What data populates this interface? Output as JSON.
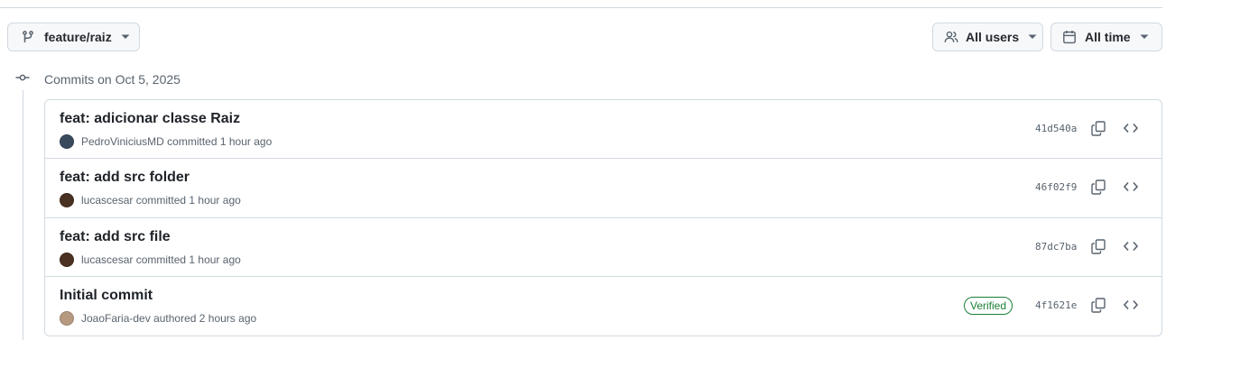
{
  "filters": {
    "branch_label": "feature/raiz",
    "users_label": "All users",
    "time_label": "All time"
  },
  "group": {
    "title": "Commits on Oct 5, 2025"
  },
  "commits": [
    {
      "message": "feat: adicionar classe Raiz",
      "author": "PedroViniciusMD",
      "action": "committed",
      "time": "1 hour ago",
      "sha": "41d540a",
      "avatar_color": "#3a4a5e"
    },
    {
      "message": "feat: add src folder",
      "author": "lucascesar",
      "action": "committed",
      "time": "1 hour ago",
      "sha": "46f02f9",
      "avatar_color": "#4a3222"
    },
    {
      "message": "feat: add src file",
      "author": "lucascesar",
      "action": "committed",
      "time": "1 hour ago",
      "sha": "87dc7ba",
      "avatar_color": "#4a3222"
    },
    {
      "message": "Initial commit",
      "author": "JoaoFaria-dev",
      "action": "authored",
      "time": "2 hours ago",
      "sha": "4f1621e",
      "verified": "Verified",
      "avatar_color": "#b59a80"
    }
  ],
  "icons": {
    "branch": "git-branch-icon",
    "users": "people-icon",
    "time": "calendar-icon",
    "caret": "triangle-down-icon",
    "group": "git-commit-icon",
    "copy": "copy-icon",
    "browse": "code-icon"
  },
  "colors": {
    "border": "#d1d9e0",
    "muted_text": "#59636e",
    "verified_green": "#1a7f37",
    "button_bg": "#f6f8fa"
  }
}
